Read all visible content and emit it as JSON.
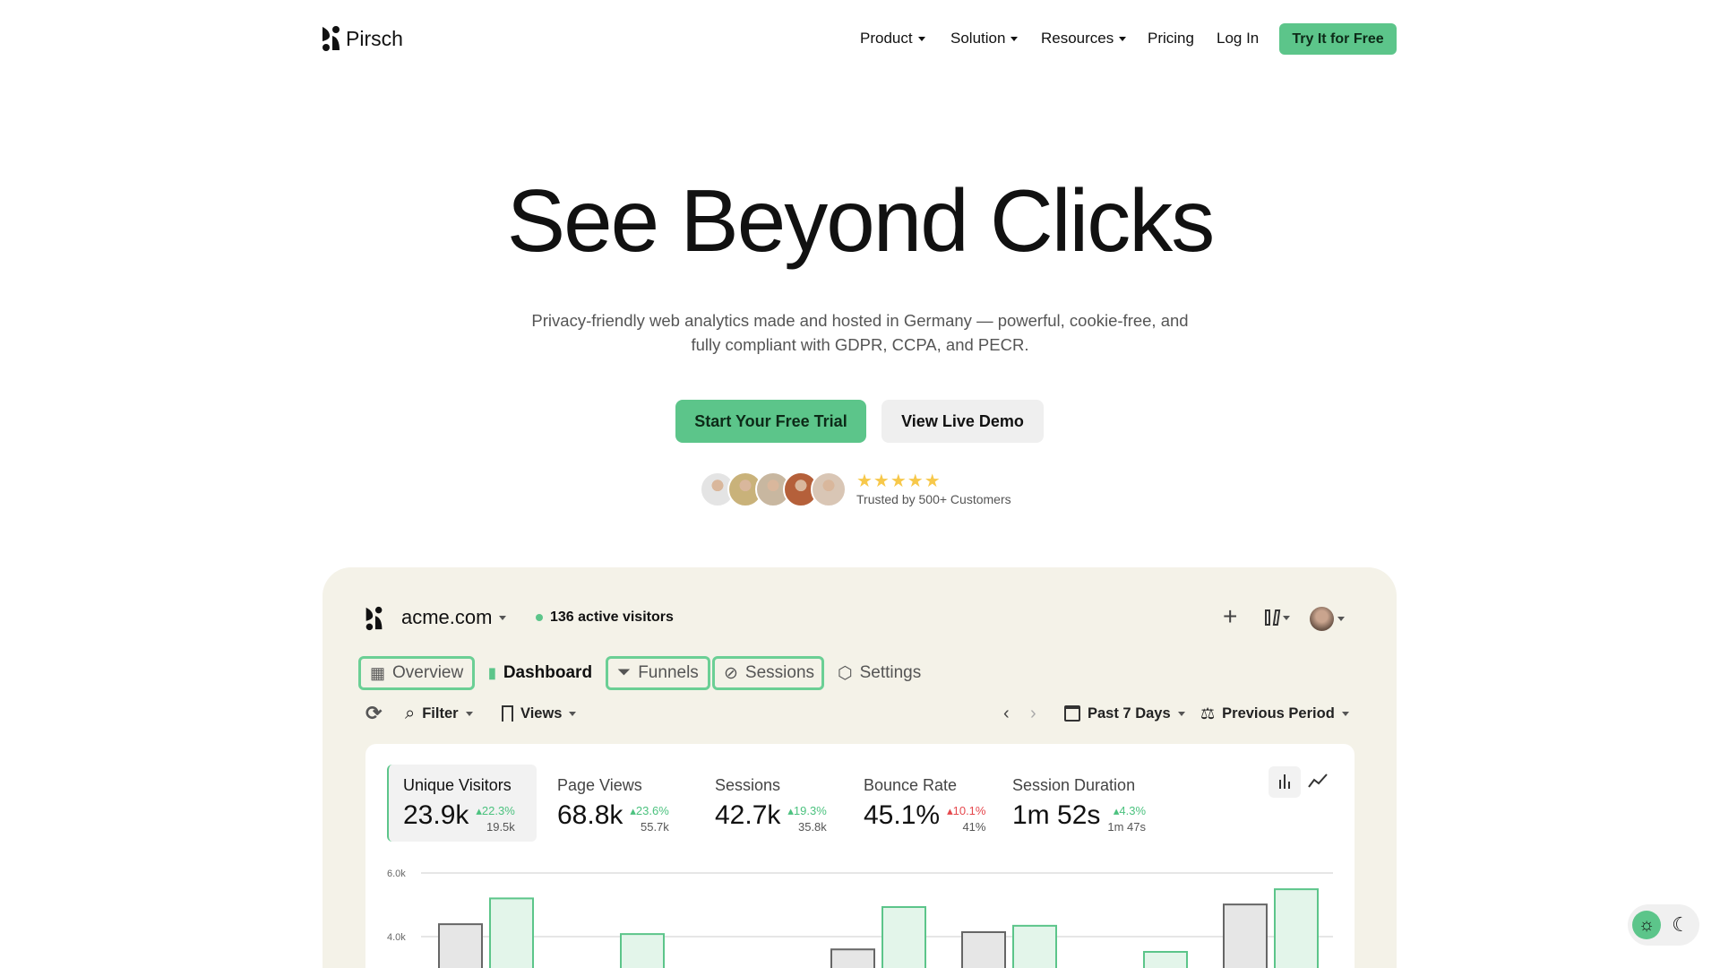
{
  "nav": {
    "brand": "Pirsch",
    "items": [
      {
        "label": "Product",
        "dropdown": true
      },
      {
        "label": "Solution",
        "dropdown": true
      },
      {
        "label": "Resources",
        "dropdown": true
      },
      {
        "label": "Pricing",
        "dropdown": false
      },
      {
        "label": "Log In",
        "dropdown": false
      }
    ],
    "cta": "Try It for Free"
  },
  "hero": {
    "title": "See Beyond Clicks",
    "subtitle_line1": "Privacy-friendly web analytics made and hosted in Germany — powerful, cookie-free, and",
    "subtitle_line2": "fully compliant with GDPR, CCPA, and PECR.",
    "primary_cta": "Start Your Free Trial",
    "secondary_cta": "View Live Demo",
    "rating_stars": 5,
    "trust_text": "Trusted by 500+ Customers",
    "avatar_colors": [
      "#e4e4e4",
      "#c9b27a",
      "#c8b7a0",
      "#b5603a",
      "#d9c6b5"
    ]
  },
  "dashboard": {
    "site": "acme.com",
    "active_visitors": "136 active visitors",
    "tabs": [
      "Overview",
      "Dashboard",
      "Funnels",
      "Sessions",
      "Settings"
    ],
    "toolbar": {
      "filter": "Filter",
      "views": "Views",
      "period": "Past 7 Days",
      "compare": "Previous Period"
    },
    "metrics": [
      {
        "label": "Unique Visitors",
        "value": "23.9k",
        "change": "22.3%",
        "dir": "up",
        "previous": "19.5k"
      },
      {
        "label": "Page Views",
        "value": "68.8k",
        "change": "23.6%",
        "dir": "up",
        "previous": "55.7k"
      },
      {
        "label": "Sessions",
        "value": "42.7k",
        "change": "19.3%",
        "dir": "up",
        "previous": "35.8k"
      },
      {
        "label": "Bounce Rate",
        "value": "45.1%",
        "change": "10.1%",
        "dir": "down",
        "previous": "41%"
      },
      {
        "label": "Session Duration",
        "value": "1m 52s",
        "change": "4.3%",
        "dir": "up",
        "previous": "1m 47s"
      }
    ]
  },
  "chart_data": {
    "type": "bar",
    "y_ticks": [
      "6.0k",
      "4.0k"
    ],
    "grid": true,
    "series": [
      {
        "values": [
          4390,
          null,
          null,
          3600,
          4140,
          null,
          5010
        ],
        "color": "#e6e6e6"
      },
      {
        "values": [
          5200,
          4080,
          null,
          4930,
          4340,
          3520,
          5490
        ],
        "color": "#e3f5ea"
      }
    ]
  },
  "theme": {
    "options": [
      "light",
      "dark"
    ],
    "active": "light",
    "accent": "#5cc58a"
  }
}
